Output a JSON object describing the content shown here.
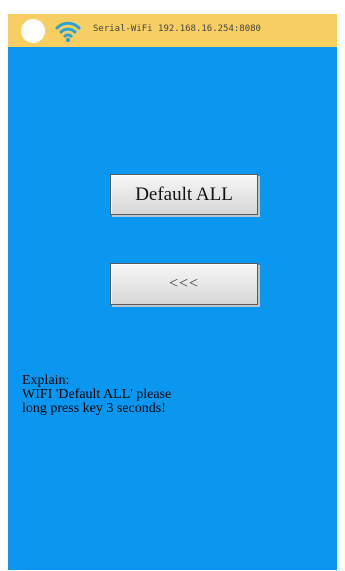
{
  "status_bar": {
    "icons": [
      "status-dot",
      "wifi-icon"
    ],
    "text": "Serial-WiFi 192.168.16.254:8080",
    "color": "#f6ce62"
  },
  "screen": {
    "background": "#0b96f0"
  },
  "buttons": {
    "default_all": "Default ALL",
    "back": "<<<"
  },
  "explain": {
    "heading": "Explain:",
    "line1": "WIFI 'Default ALL' please",
    "line2": "long press key 3 seconds!"
  }
}
